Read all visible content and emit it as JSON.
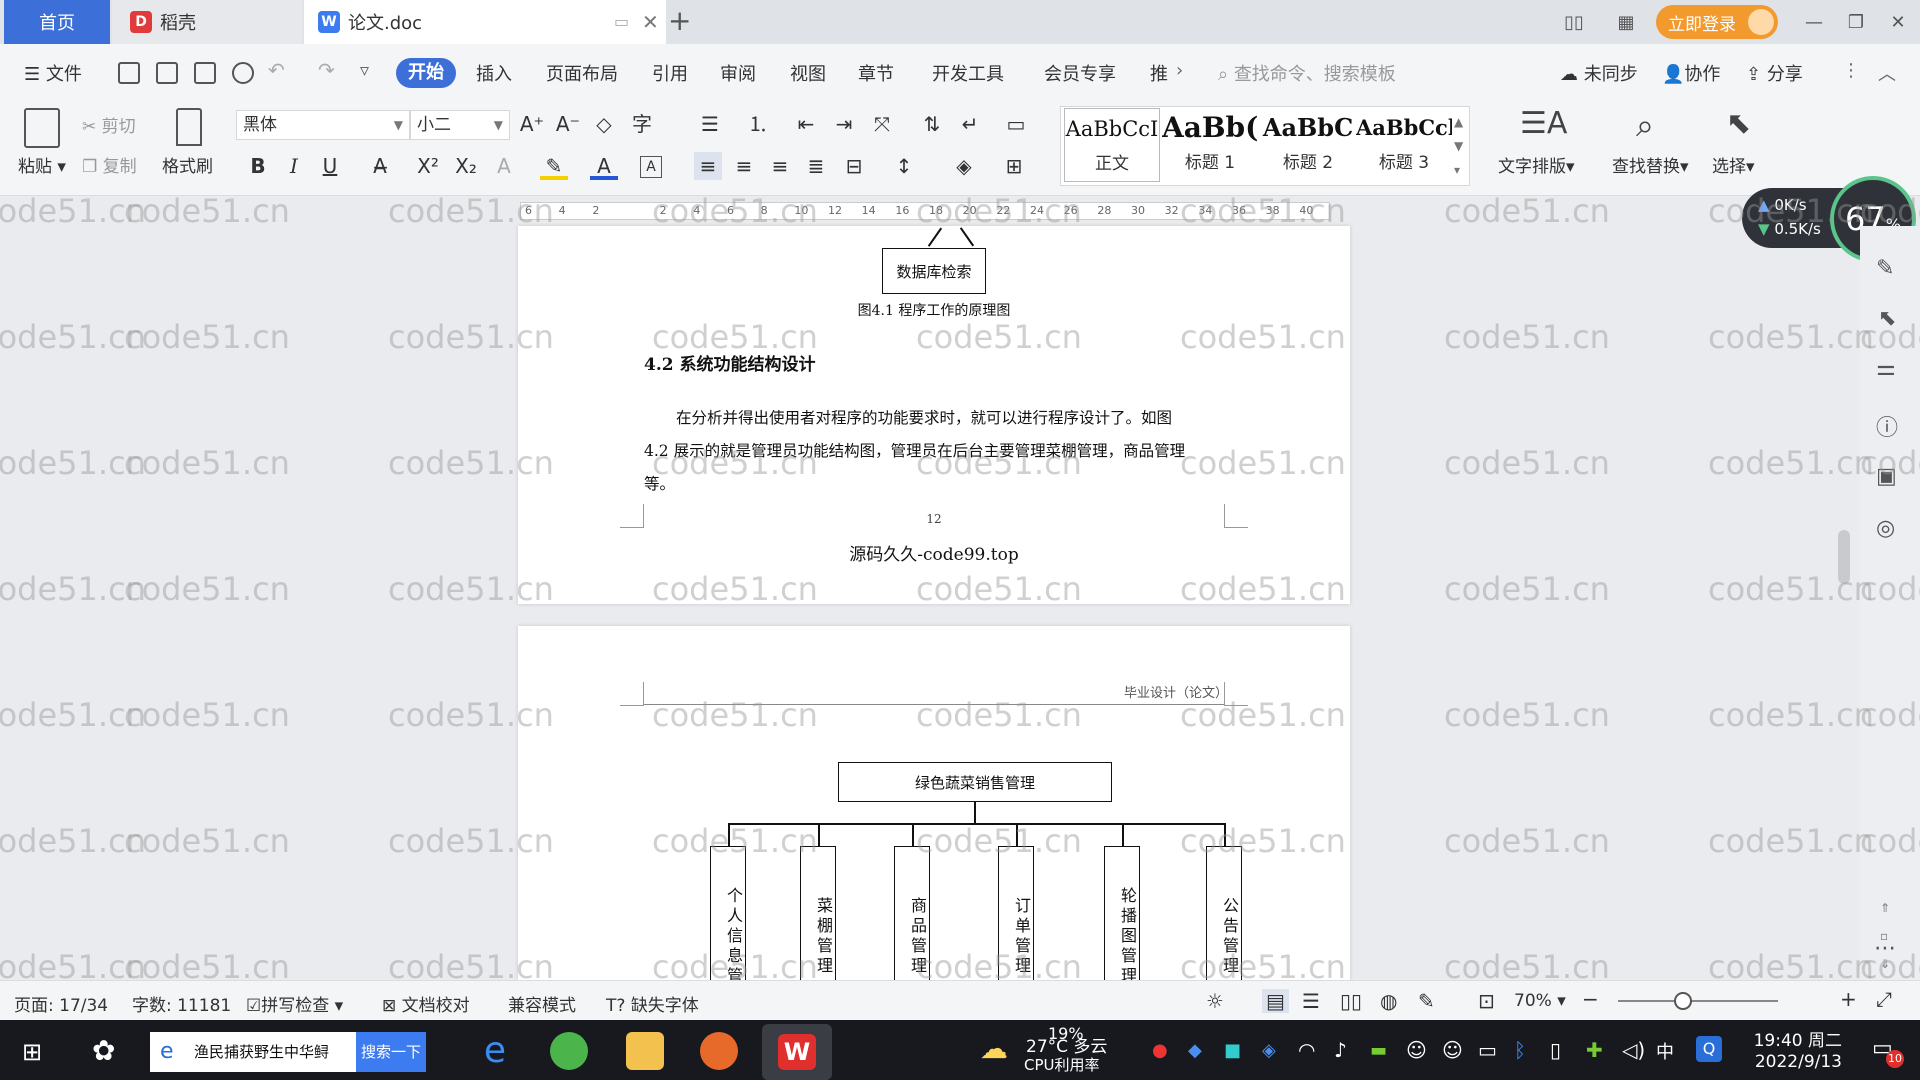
{
  "tabs": {
    "home": "首页",
    "daoke": "稻壳",
    "doc": "论文.doc"
  },
  "titlebar": {
    "login": "立即登录"
  },
  "menu": {
    "file": "文件",
    "items": [
      "开始",
      "插入",
      "页面布局",
      "引用",
      "审阅",
      "视图",
      "章节",
      "开发工具",
      "会员专享",
      "推"
    ],
    "search_cmd": "查找命令、搜索模板",
    "unsynced": "未同步",
    "collab": "协作",
    "share": "分享"
  },
  "ribbon": {
    "paste": "粘贴",
    "cut": "剪切",
    "copy": "复制",
    "format_painter": "格式刷",
    "font_name": "黑体",
    "font_size": "小二",
    "styles": [
      {
        "sample": "AaBbCcI",
        "name": "正文"
      },
      {
        "sample": "AaBb(",
        "name": "标题 1"
      },
      {
        "sample": "AaBbC",
        "name": "标题 2"
      },
      {
        "sample": "AaBbCcl",
        "name": "标题 3"
      }
    ],
    "text_layout": "文字排版",
    "find_replace": "查找替换",
    "select": "选择"
  },
  "ruler": {
    "ticks": [
      "6",
      "4",
      "2",
      "",
      "2",
      "4",
      "6",
      "8",
      "10",
      "12",
      "14",
      "16",
      "18",
      "20",
      "22",
      "24",
      "26",
      "28",
      "30",
      "32",
      "34",
      "36",
      "38",
      "40"
    ]
  },
  "network": {
    "up": "0K/s",
    "down": "0.5K/s",
    "cpu": "67",
    "cpu_unit": "%"
  },
  "page1": {
    "top_box": "数据库检索",
    "figure_caption": "图4.1 程序工作的原理图",
    "heading": "4.2  系统功能结构设计",
    "para_line1": "在分析并得出使用者对程序的功能要求时，就可以进行程序设计了。如图",
    "para_line2": "4.2 展示的就是管理员功能结构图，管理员在后台主要管理菜棚管理，商品管理",
    "para_line3": "等。",
    "page_number": "12",
    "footer": "源码久久-code99.top"
  },
  "page2": {
    "header": "毕业设计（论文）",
    "root": "绿色蔬菜销售管理",
    "children": [
      "个人信息管",
      "菜棚管理",
      "商品管理",
      "订单管理",
      "轮播图管理",
      "公告管理"
    ]
  },
  "status": {
    "page": "页面: 17/34",
    "words": "字数: 11181",
    "spell": "拼写检查",
    "proof": "文档校对",
    "compat": "兼容模式",
    "missing_font": "缺失字体",
    "zoom": "70%"
  },
  "taskbar": {
    "search_text": "渔民捕获野生中华鲟",
    "search_btn": "搜索一下",
    "weather_temp": "27°C",
    "weather_text": "多云",
    "cpu_label": "19%",
    "cpu_sub": "CPU利用率",
    "ime": "中",
    "time": "19:40 周二",
    "date": "2022/9/13",
    "notif": "10"
  },
  "watermark": "code51.cn"
}
